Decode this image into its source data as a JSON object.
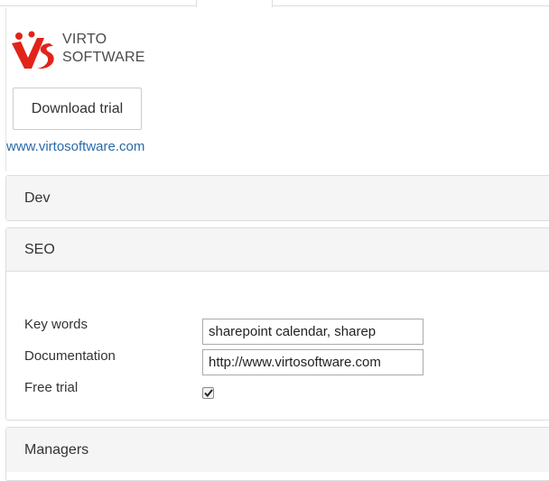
{
  "logo": {
    "line1": "VIRTO",
    "line2": "SOFTWARE",
    "brand_red": "#e2231a",
    "icon": "virto-logo-icon"
  },
  "download_button": "Download trial",
  "website_link": "www.virtosoftware.com",
  "panels": {
    "dev": {
      "title": "Dev",
      "state": "collapsed"
    },
    "seo": {
      "title": "SEO",
      "state": "expanded",
      "fields": {
        "keywords": {
          "label": "Key words",
          "value": "sharepoint calendar, sharep"
        },
        "documentation": {
          "label": "Documentation",
          "value": "http://www.virtosoftware.com"
        },
        "free_trial": {
          "label": "Free trial",
          "checked": true
        }
      }
    },
    "managers": {
      "title": "Managers",
      "state": "collapsed"
    }
  },
  "colors": {
    "link": "#2a6aa8",
    "panel_header_bg": "#f5f5f5",
    "border": "#dddddd"
  }
}
